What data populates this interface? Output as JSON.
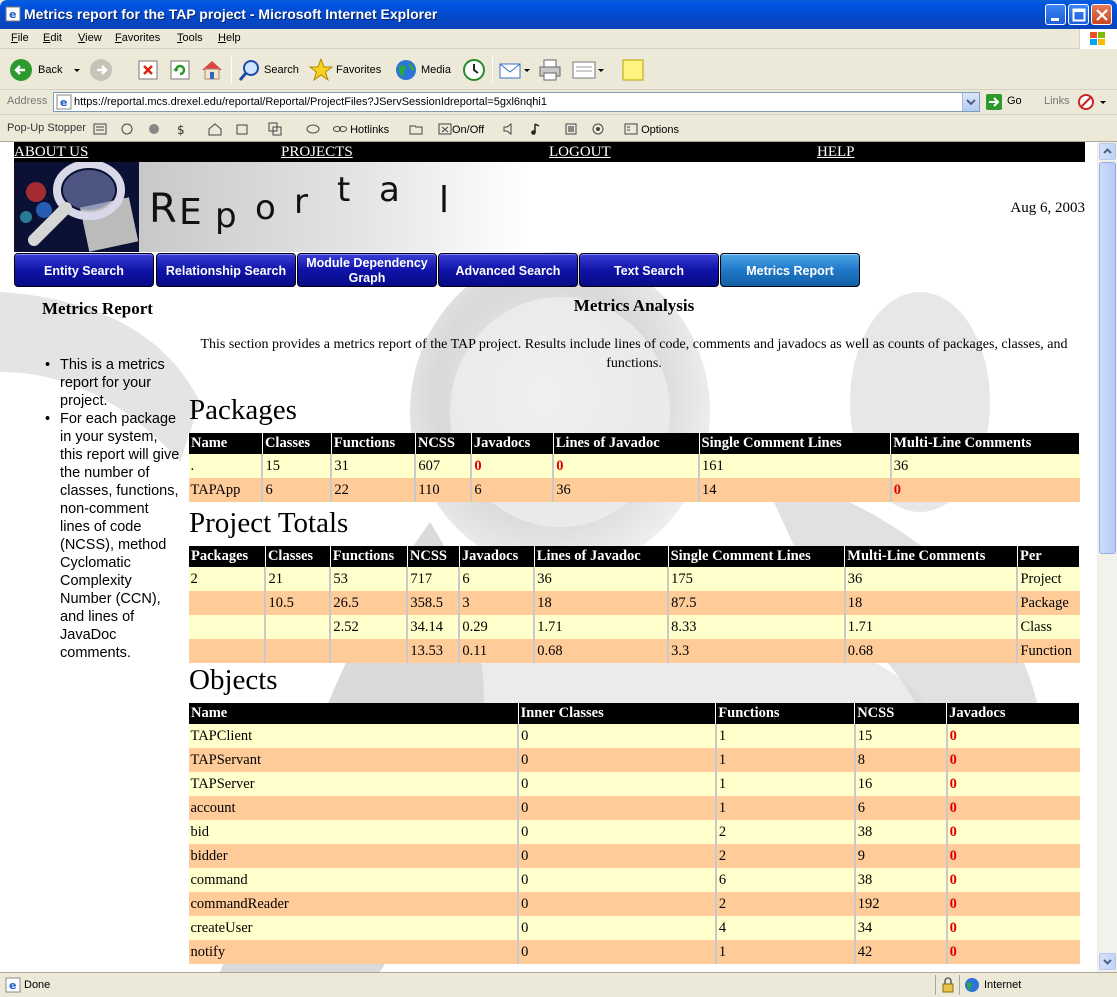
{
  "window": {
    "title": "Metrics report for the TAP project - Microsoft Internet Explorer"
  },
  "menu": [
    "File",
    "Edit",
    "View",
    "Favorites",
    "Tools",
    "Help"
  ],
  "toolbar": {
    "back": "Back",
    "search": "Search",
    "favorites": "Favorites",
    "media": "Media"
  },
  "address": {
    "label": "Address",
    "url": "https://reportal.mcs.drexel.edu/reportal/Reportal/ProjectFiles?JServSessionIdreportal=5gxl6nqhi1",
    "go": "Go",
    "links": "Links"
  },
  "popup": {
    "label": "Pop-Up Stopper",
    "hotlinks": "Hotlinks",
    "onoff": "On/Off",
    "options": "Options"
  },
  "status": {
    "text": "Done",
    "zone": "Internet"
  },
  "page": {
    "topnav": [
      "ABOUT US",
      "PROJECTS",
      "LOGOUT",
      "HELP"
    ],
    "logo_letters": [
      "R",
      "E",
      "p",
      "o",
      "r",
      "t",
      "a",
      "l"
    ],
    "date": "Aug 6, 2003",
    "nav_buttons": [
      "Entity Search",
      "Relationship Search",
      "Module Dependency Graph",
      "Advanced Search",
      "Text Search",
      "Metrics Report"
    ],
    "active_nav": "Metrics Report",
    "sidebar": {
      "title": "Metrics Report",
      "items": [
        "This is a metrics report for your project.",
        "For each package in your system, this report will give the number of classes, functions, non-comment lines of code (NCSS), method Cyclomatic Complexity Number (CCN), and lines of JavaDoc comments."
      ]
    },
    "main": {
      "title": "Metrics Analysis",
      "intro": "This section provides a metrics report of the TAP project. Results include lines of code, comments and javadocs as well as counts of packages, classes, and functions."
    },
    "packages": {
      "heading": "Packages",
      "columns": [
        "Name",
        "Classes",
        "Functions",
        "NCSS",
        "Javadocs",
        "Lines of Javadoc",
        "Single Comment Lines",
        "Multi-Line Comments"
      ],
      "rows": [
        [
          ".",
          "15",
          "31",
          "607",
          "0",
          "0",
          "161",
          "36"
        ],
        [
          "TAPApp",
          "6",
          "22",
          "110",
          "6",
          "36",
          "14",
          "0"
        ]
      ]
    },
    "totals": {
      "heading": "Project Totals",
      "columns": [
        "Packages",
        "Classes",
        "Functions",
        "NCSS",
        "Javadocs",
        "Lines of Javadoc",
        "Single Comment Lines",
        "Multi-Line Comments",
        "Per"
      ],
      "rows": [
        [
          "2",
          "21",
          "53",
          "717",
          "6",
          "36",
          "175",
          "36",
          "Project"
        ],
        [
          "",
          "10.5",
          "26.5",
          "358.5",
          "3",
          "18",
          "87.5",
          "18",
          "Package"
        ],
        [
          "",
          "",
          "2.52",
          "34.14",
          "0.29",
          "1.71",
          "8.33",
          "1.71",
          "Class"
        ],
        [
          "",
          "",
          "",
          "13.53",
          "0.11",
          "0.68",
          "3.3",
          "0.68",
          "Function"
        ]
      ]
    },
    "objects": {
      "heading": "Objects",
      "columns": [
        "Name",
        "Inner Classes",
        "Functions",
        "NCSS",
        "Javadocs"
      ],
      "rows": [
        [
          "TAPClient",
          "0",
          "1",
          "15",
          "0"
        ],
        [
          "TAPServant",
          "0",
          "1",
          "8",
          "0"
        ],
        [
          "TAPServer",
          "0",
          "1",
          "16",
          "0"
        ],
        [
          "account",
          "0",
          "1",
          "6",
          "0"
        ],
        [
          "bid",
          "0",
          "2",
          "38",
          "0"
        ],
        [
          "bidder",
          "0",
          "2",
          "9",
          "0"
        ],
        [
          "command",
          "0",
          "6",
          "38",
          "0"
        ],
        [
          "commandReader",
          "0",
          "2",
          "192",
          "0"
        ],
        [
          "createUser",
          "0",
          "4",
          "34",
          "0"
        ],
        [
          "notify",
          "0",
          "1",
          "42",
          "0"
        ]
      ]
    }
  }
}
